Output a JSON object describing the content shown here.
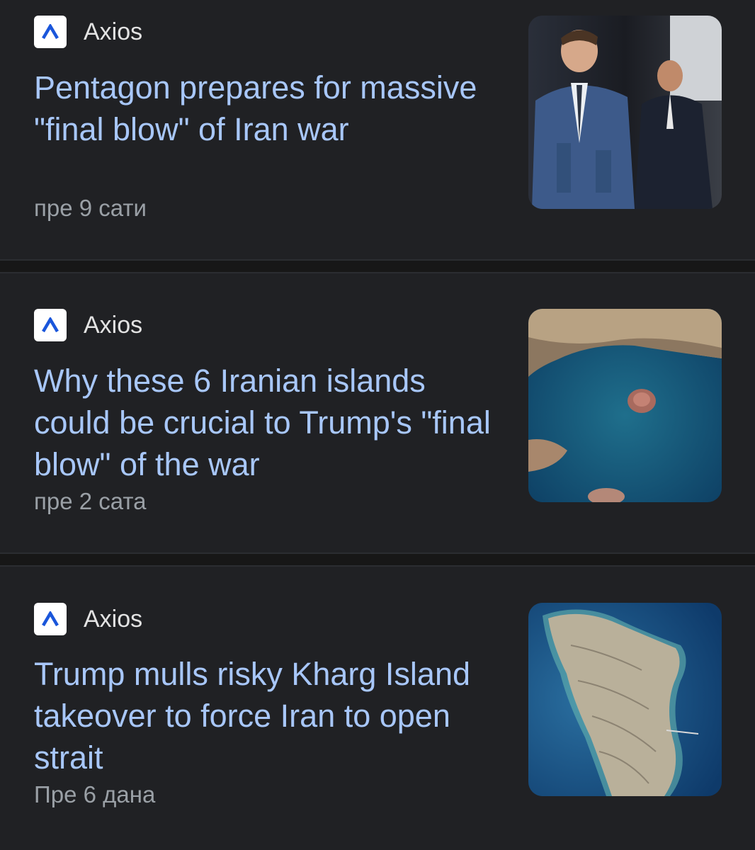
{
  "articles": [
    {
      "source": "Axios",
      "headline": "Pentagon prepares for massive \"final blow\" of Iran war",
      "time": "пре 9 сати",
      "thumbnail": "pentagon-officials-photo"
    },
    {
      "source": "Axios",
      "headline": "Why these 6 Iranian islands could be crucial to Trump's \"final blow\" of the war",
      "time": "пре 2 сата",
      "thumbnail": "satellite-islands-photo"
    },
    {
      "source": "Axios",
      "headline": "Trump mulls risky Kharg Island takeover to force Iran to open strait",
      "time": "Пре 6 дана",
      "thumbnail": "kharg-island-satellite-photo"
    }
  ],
  "colors": {
    "background": "#202124",
    "headline": "#a8c7fa",
    "source": "#e3e3e3",
    "time": "#9aa0a6",
    "logo_mark": "#1a56db"
  }
}
